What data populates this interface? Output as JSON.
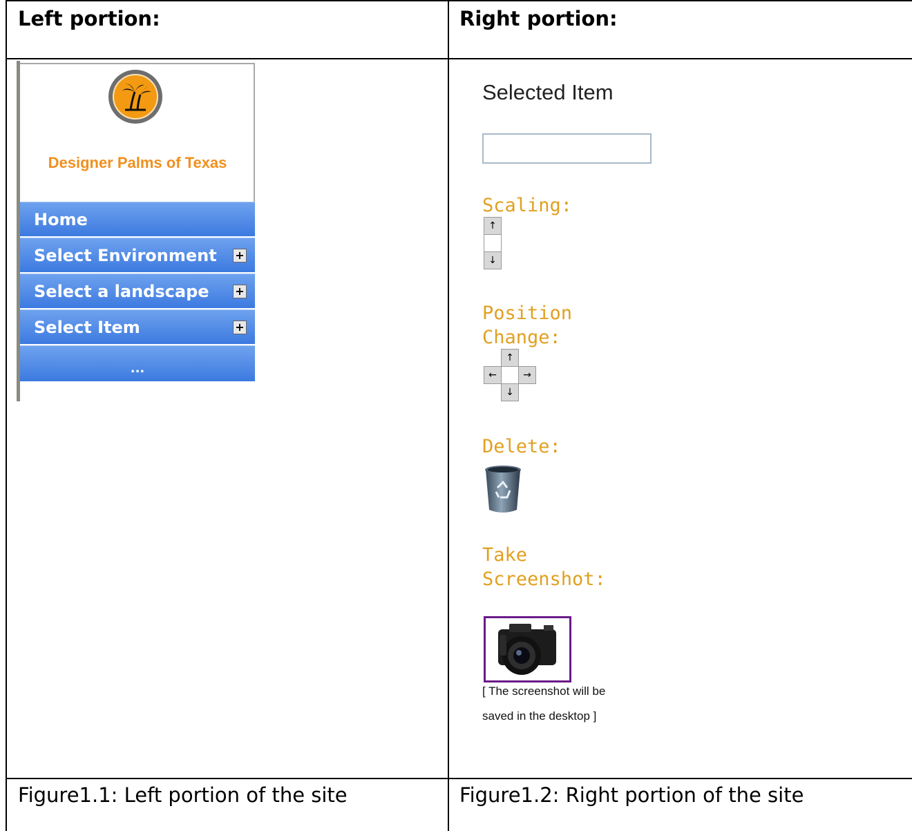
{
  "table": {
    "header_left": "Left portion:",
    "header_right": "Right portion:",
    "caption_left": "Figure1.1: Left portion of the site",
    "caption_right": "Figure1.2: Right portion of the site"
  },
  "left_site": {
    "brand": "Designer Palms of Texas",
    "logo_icon": "palm-tree-logo-icon",
    "menu": [
      {
        "label": "Home",
        "expandable": false
      },
      {
        "label": "Select Environment",
        "expandable": true
      },
      {
        "label": "Select a landscape",
        "expandable": true
      },
      {
        "label": "Select Item",
        "expandable": true
      }
    ],
    "menu_more": "...",
    "expand_symbol": "+"
  },
  "right_site": {
    "selected_item_title": "Selected Item",
    "selected_item_value": "",
    "scaling_label": "Scaling:",
    "position_label_line1": "Position",
    "position_label_line2": "Change:",
    "delete_label": "Delete:",
    "screenshot_label_line1": "Take",
    "screenshot_label_line2": "Screenshot:",
    "note_line1": "[ The screenshot will be",
    "note_line2": "saved in the desktop ]",
    "arrow_up": "↑",
    "arrow_down": "↓",
    "arrow_left": "←",
    "arrow_right": "→"
  },
  "colors": {
    "menu_blue": "#4a86e8",
    "brand_orange": "#f0901e",
    "label_gold": "#e0a020",
    "camera_border": "#6a1a8a"
  }
}
